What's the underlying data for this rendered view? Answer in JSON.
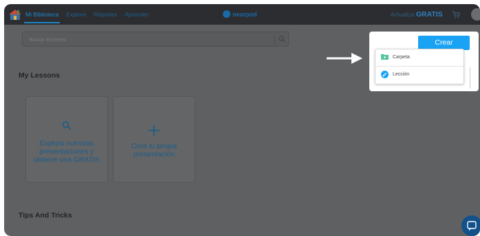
{
  "nav": {
    "items": [
      {
        "label": "Mi Biblioteca",
        "active": true
      },
      {
        "label": "Explore"
      },
      {
        "label": "Reportes"
      },
      {
        "label": "Aprender"
      }
    ],
    "brand": "nearpod",
    "upgrade_prefix": "Actualiza",
    "upgrade_highlight": "GRATIS"
  },
  "search": {
    "placeholder": "Buscar lecciones"
  },
  "sections": {
    "lessons_title": "My Lessons",
    "tips_title": "Tips And Tricks"
  },
  "cards": [
    {
      "icon": "search-icon",
      "text": "Explora nuestras presentaciones y obtiene una GRATIS"
    },
    {
      "icon": "plus-icon",
      "text": "Crea tu propia presentación"
    }
  ],
  "create": {
    "button_label": "Crear",
    "menu": [
      {
        "icon": "folder-icon",
        "label": "Carpeta"
      },
      {
        "icon": "lesson-icon",
        "label": "Lección"
      }
    ]
  },
  "colors": {
    "accent": "#1aa3f4",
    "overlay": "#5f6061",
    "topbar": "#2b2d31",
    "card_text": "#1a5c8c"
  }
}
